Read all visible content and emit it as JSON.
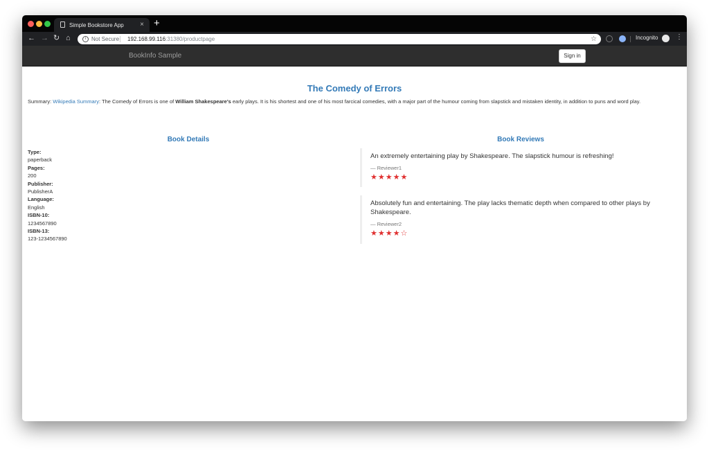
{
  "browser": {
    "tab_title": "Simple Bookstore App",
    "tab_close": "×",
    "new_tab": "+",
    "security_label": "Not Secure",
    "url_host": "192.168.99.116",
    "url_rest": ":31380/productpage",
    "incognito_label": "Incognito"
  },
  "navbar": {
    "brand": "BookInfo Sample",
    "sign_in": "Sign in"
  },
  "book": {
    "title": "The Comedy of Errors",
    "summary_label": "Summary: ",
    "summary_link": "Wikipedia Summary",
    "summary_before": ": The Comedy of Errors is one of ",
    "summary_bold": "William Shakespeare's",
    "summary_after": " early plays. It is his shortest and one of his most farcical comedies, with a major part of the humour coming from slapstick and mistaken identity, in addition to puns and word play."
  },
  "details": {
    "heading": "Book Details",
    "items": [
      {
        "label": "Type:",
        "value": "paperback"
      },
      {
        "label": "Pages:",
        "value": "200"
      },
      {
        "label": "Publisher:",
        "value": "PublisherA"
      },
      {
        "label": "Language:",
        "value": "English"
      },
      {
        "label": "ISBN-10:",
        "value": "1234567890"
      },
      {
        "label": "ISBN-13:",
        "value": "123-1234567890"
      }
    ]
  },
  "reviews": {
    "heading": "Book Reviews",
    "star_color": "#e03030",
    "items": [
      {
        "text": "An extremely entertaining play by Shakespeare. The slapstick humour is refreshing!",
        "reviewer": "— Reviewer1",
        "stars": "★★★★★",
        "rating": 5
      },
      {
        "text": "Absolutely fun and entertaining. The play lacks thematic depth when compared to other plays by Shakespeare.",
        "reviewer": "— Reviewer2",
        "stars": "★★★★☆",
        "rating": 4
      }
    ]
  },
  "colors": {
    "link": "#337ab7",
    "navbar": "#2e2e2e"
  }
}
